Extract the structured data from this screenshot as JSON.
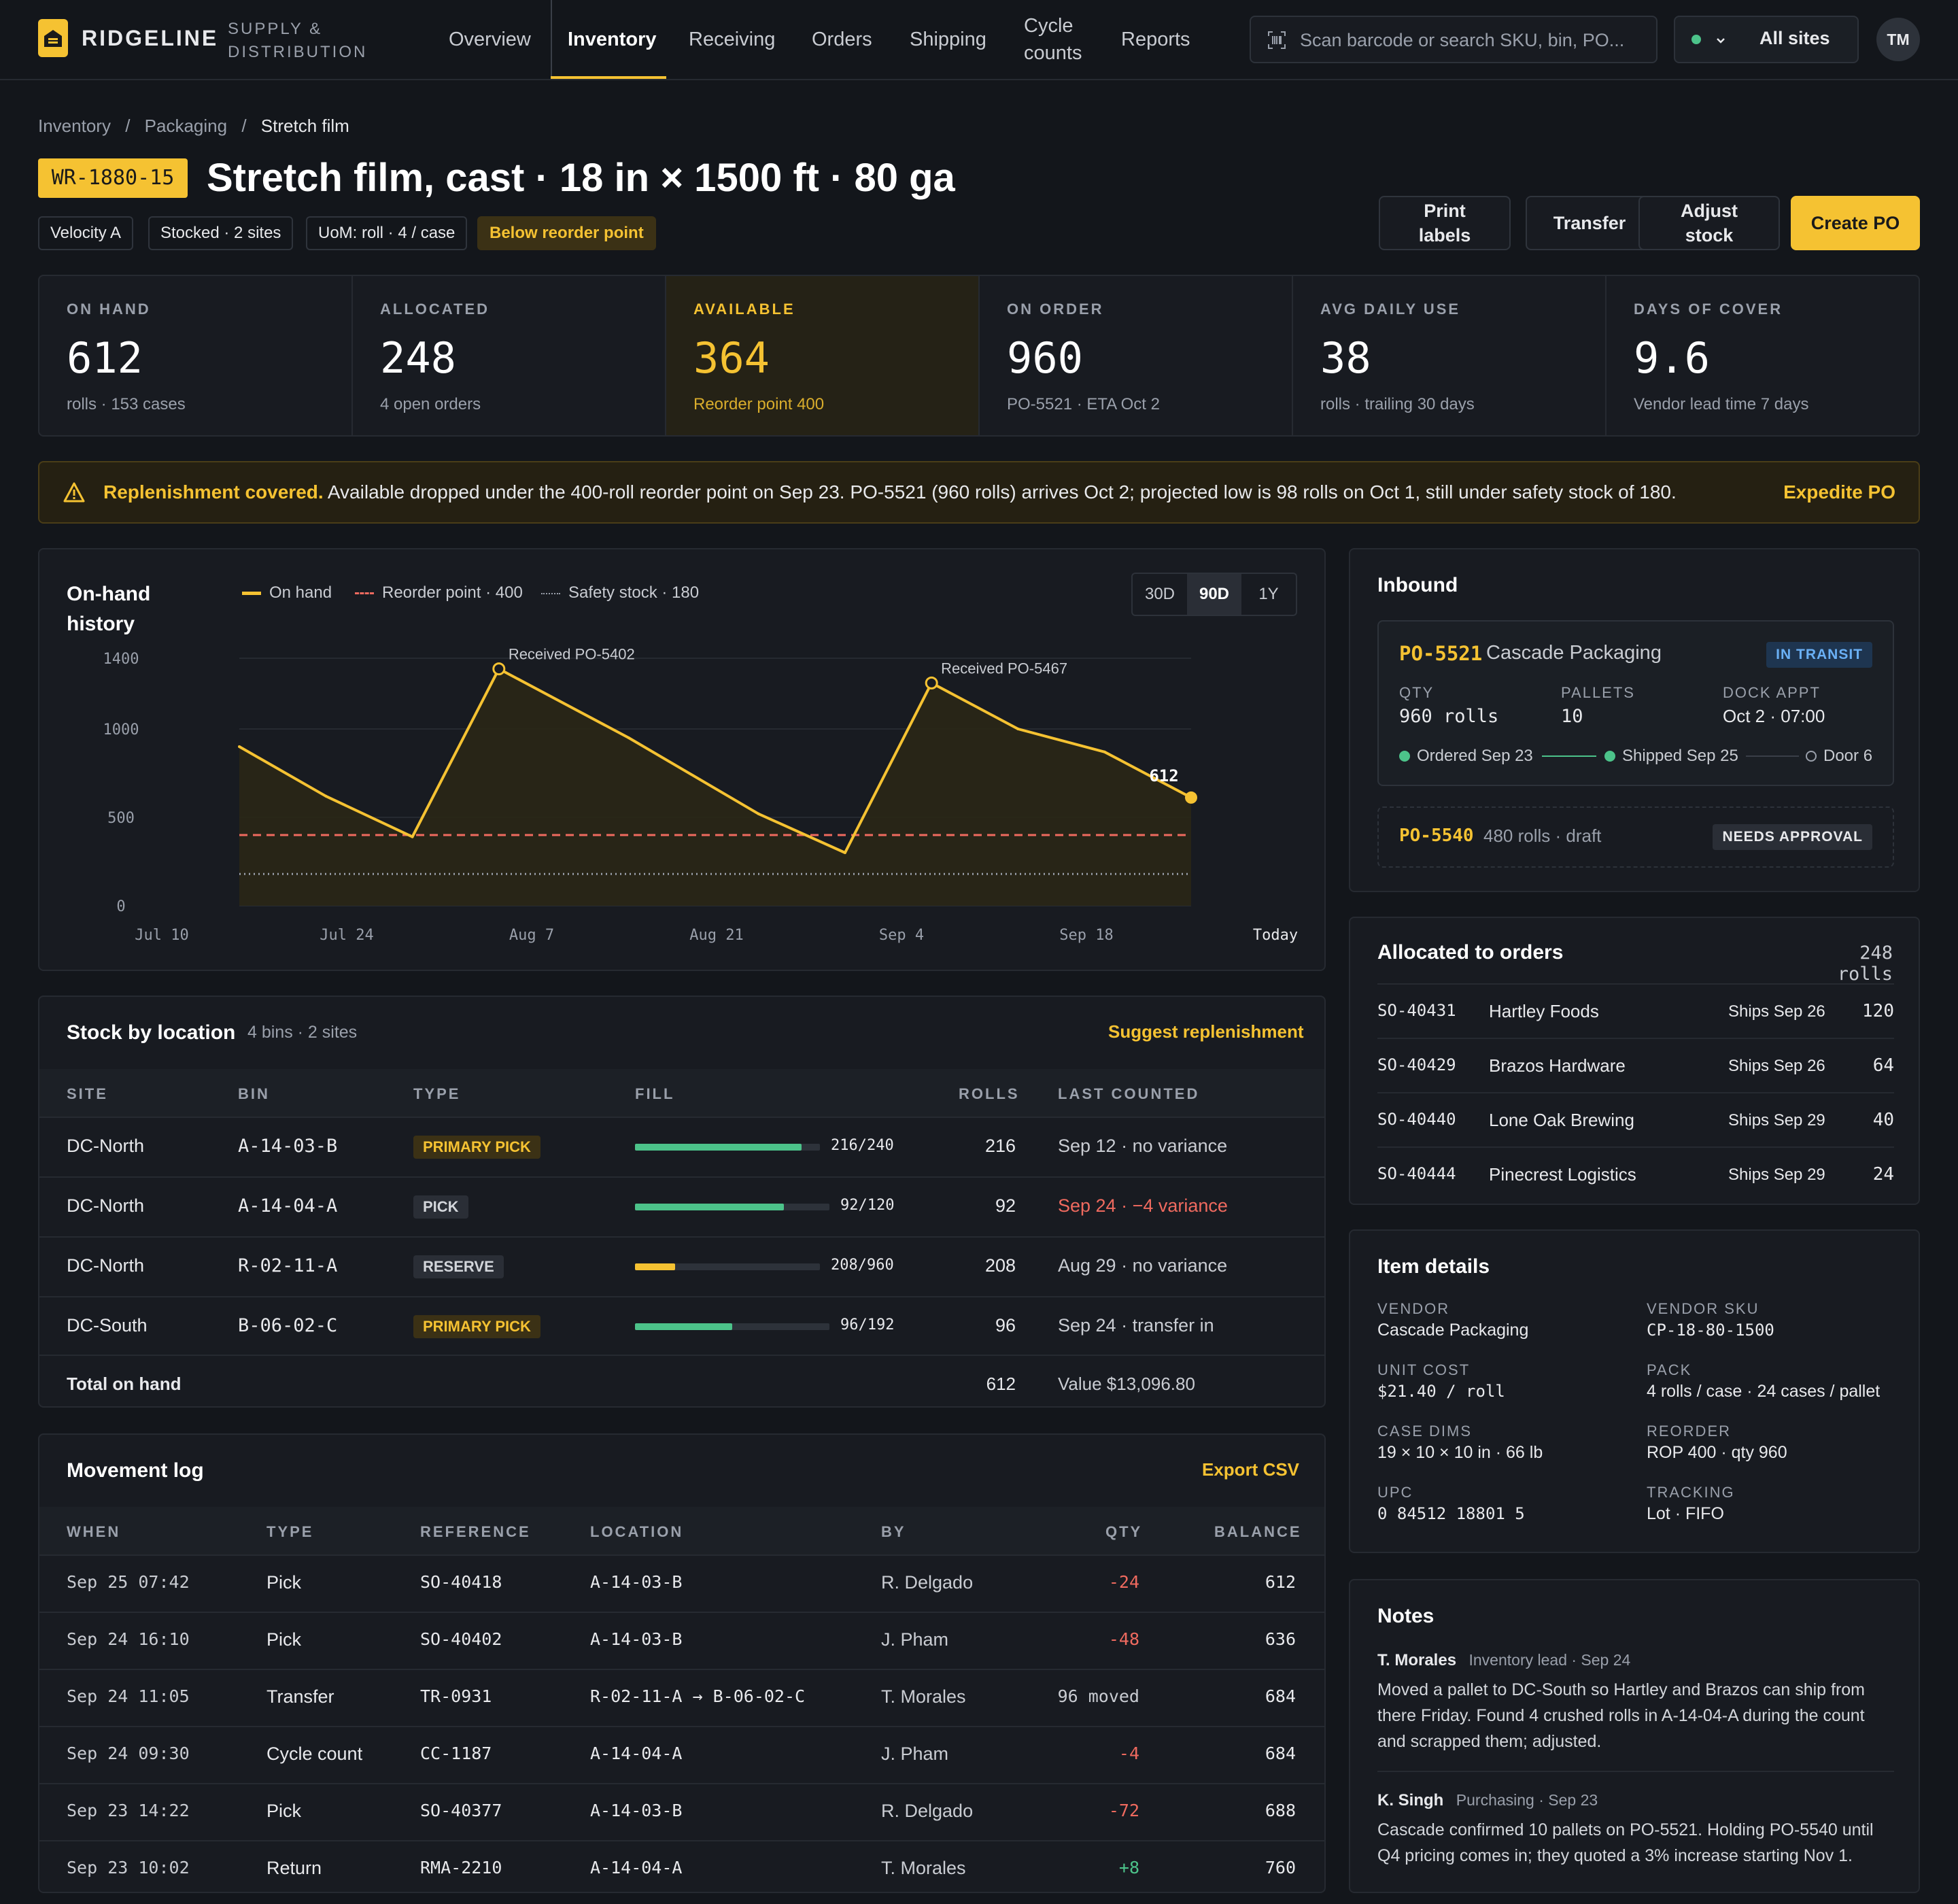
{
  "brand": {
    "name": "RIDGELINE",
    "sub": "SUPPLY & DISTRIBUTION"
  },
  "nav": [
    "Overview",
    "Inventory",
    "Receiving",
    "Orders",
    "Shipping",
    "Cycle counts",
    "Reports"
  ],
  "search": {
    "placeholder": "Scan barcode or search SKU, bin, PO..."
  },
  "sites": {
    "label": "All sites"
  },
  "user": {
    "initials": "TM"
  },
  "breadcrumb": [
    "Inventory",
    "Packaging",
    "Stretch film"
  ],
  "item": {
    "sku": "WR-1880-15",
    "title": "Stretch film, cast · 18 in × 1500 ft · 80 ga",
    "chips": [
      "Velocity A",
      "Stocked · 2 sites",
      "UoM: roll · 4 / case",
      "Below reorder point"
    ]
  },
  "actions": {
    "print": "Print labels",
    "transfer": "Transfer",
    "adjust": "Adjust stock",
    "create": "Create PO"
  },
  "kpis": [
    {
      "label": "ON HAND",
      "value": "612",
      "sub": "rolls · 153 cases"
    },
    {
      "label": "ALLOCATED",
      "value": "248",
      "sub": "4 open orders"
    },
    {
      "label": "AVAILABLE",
      "value": "364",
      "sub": "Reorder point 400"
    },
    {
      "label": "ON ORDER",
      "value": "960",
      "sub": "PO-5521 · ETA Oct 2"
    },
    {
      "label": "AVG DAILY USE",
      "value": "38",
      "sub": "rolls · trailing 30 days"
    },
    {
      "label": "DAYS OF COVER",
      "value": "9.6",
      "sub": "Vendor lead time 7 days"
    }
  ],
  "banner": {
    "bold": "Replenishment covered.",
    "text": "Available dropped under the 400-roll reorder point on Sep 23. PO-5521 (960 rolls) arrives Oct 2; projected low is 98 rolls on Oct 1, still under safety stock of 180.",
    "action": "Expedite PO"
  },
  "chart_card": {
    "title": "On-hand history",
    "ranges": [
      "30D",
      "90D",
      "1Y"
    ],
    "active_range": "90D"
  },
  "chart_data": {
    "type": "line",
    "title": "On-hand history",
    "series": [
      {
        "name": "On hand",
        "color": "#f5c232",
        "x": [
          0,
          10,
          20,
          30,
          45,
          60,
          70,
          80,
          90,
          100,
          110
        ],
        "values": [
          900,
          620,
          390,
          1340,
          950,
          520,
          300,
          1260,
          1000,
          870,
          612
        ]
      }
    ],
    "reference_lines": [
      {
        "name": "Reorder point · 400",
        "value": 400,
        "style": "dashed",
        "color": "#ef6a5f"
      },
      {
        "name": "Safety stock · 180",
        "value": 180,
        "style": "dotted",
        "color": "#9aa0ab"
      }
    ],
    "annotations": [
      {
        "x": 30,
        "y": 1340,
        "text": "Received PO-5402"
      },
      {
        "x": 80,
        "y": 1260,
        "text": "Received PO-5467"
      },
      {
        "x": 110,
        "y": 612,
        "text": "612"
      }
    ],
    "x_tick_labels": [
      "Jul 10",
      "Jul 24",
      "Aug 7",
      "Aug 21",
      "Sep 4",
      "Sep 18",
      "Today"
    ],
    "x_ticks": [
      0,
      14,
      28,
      42,
      56,
      70,
      84
    ],
    "y_ticks": [
      0,
      500,
      1000,
      1400
    ],
    "ylim": [
      0,
      1400
    ],
    "legend": "top"
  },
  "inbound": {
    "title": "Inbound",
    "po": "PO-5521",
    "vendor": "Cascade Packaging",
    "status": "IN TRANSIT",
    "qty_label": "QTY",
    "qty": "960 rolls",
    "pallets_label": "PALLETS",
    "pallets": "10",
    "dock_label": "DOCK APPT",
    "dock": "Oct 2 · 07:00",
    "steps": [
      "Ordered Sep 23",
      "Shipped Sep 25",
      "Door 6"
    ],
    "draft_po": "PO-5540",
    "draft_text": "480 rolls · draft",
    "draft_status": "NEEDS APPROVAL"
  },
  "allocated": {
    "title": "Allocated to orders",
    "total": "248 rolls",
    "rows": [
      {
        "so": "SO-40431",
        "customer": "Hartley Foods",
        "ships": "Ships Sep 26",
        "qty": "120"
      },
      {
        "so": "SO-40429",
        "customer": "Brazos Hardware",
        "ships": "Ships Sep 26",
        "qty": "64"
      },
      {
        "so": "SO-40440",
        "customer": "Lone Oak Brewing",
        "ships": "Ships Sep 29",
        "qty": "40"
      },
      {
        "so": "SO-40444",
        "customer": "Pinecrest Logistics",
        "ships": "Ships Sep 29",
        "qty": "24"
      }
    ]
  },
  "details": {
    "title": "Item details",
    "fields": [
      {
        "label": "VENDOR",
        "value": "Cascade Packaging"
      },
      {
        "label": "VENDOR SKU",
        "value": "CP-18-80-1500"
      },
      {
        "label": "UNIT COST",
        "value": "$21.40 / roll"
      },
      {
        "label": "PACK",
        "value": "4 rolls / case · 24 cases / pallet"
      },
      {
        "label": "CASE DIMS",
        "value": "19 × 10 × 10 in · 66 lb"
      },
      {
        "label": "REORDER",
        "value": "ROP 400 · qty 960"
      },
      {
        "label": "UPC",
        "value": "0 84512 18801 5"
      },
      {
        "label": "TRACKING",
        "value": "Lot · FIFO"
      }
    ]
  },
  "notes": {
    "title": "Notes",
    "items": [
      {
        "author": "T. Morales",
        "meta": "Inventory lead · Sep 24",
        "text": "Moved a pallet to DC-South so Hartley and Brazos can ship from there Friday. Found 4 crushed rolls in A-14-04-A during the count and scrapped them; adjusted."
      },
      {
        "author": "K. Singh",
        "meta": "Purchasing · Sep 23",
        "text": "Cascade confirmed 10 pallets on PO-5521. Holding PO-5540 until Q4 pricing comes in; they quoted a 3% increase starting Nov 1."
      }
    ]
  },
  "stock": {
    "title": "Stock by location",
    "meta": "4 bins · 2 sites",
    "action": "Suggest replenishment",
    "headers": [
      "SITE",
      "BIN",
      "TYPE",
      "FILL",
      "ROLLS",
      "LAST COUNTED"
    ],
    "rows": [
      {
        "site": "DC-North",
        "bin": "A-14-03-B",
        "type": "PRIMARY PICK",
        "fill": 0.9,
        "fill_text": "216/240",
        "rolls": "216",
        "counted": "Sep 12 · no variance",
        "color": "#4cc38a"
      },
      {
        "site": "DC-North",
        "bin": "A-14-04-A",
        "type": "PICK",
        "fill": 0.7667,
        "fill_text": "92/120",
        "rolls": "92",
        "counted": "Sep 24 · −4 variance",
        "color": "#4cc38a"
      },
      {
        "site": "DC-North",
        "bin": "R-02-11-A",
        "type": "RESERVE",
        "fill": 0.2167,
        "fill_text": "208/960",
        "rolls": "208",
        "counted": "Aug 29 · no variance",
        "color": "#f5c232"
      },
      {
        "site": "DC-South",
        "bin": "B-06-02-C",
        "type": "PRIMARY PICK",
        "fill": 0.5,
        "fill_text": "96/192",
        "rolls": "96",
        "counted": "Sep 24 · transfer in",
        "color": "#4cc38a"
      }
    ],
    "total_label": "Total on hand",
    "total": "612",
    "value": "Value $13,096.80"
  },
  "movement": {
    "title": "Movement log",
    "action": "Export CSV",
    "headers": [
      "WHEN",
      "TYPE",
      "REFERENCE",
      "LOCATION",
      "BY",
      "QTY",
      "BALANCE"
    ],
    "rows": [
      {
        "when": "Sep 25 07:42",
        "type": "Pick",
        "ref": "SO-40418",
        "loc": "A-14-03-B",
        "by": "R. Delgado",
        "qty": "-24",
        "bal": "612"
      },
      {
        "when": "Sep 24 16:10",
        "type": "Pick",
        "ref": "SO-40402",
        "loc": "A-14-03-B",
        "by": "J. Pham",
        "qty": "-48",
        "bal": "636"
      },
      {
        "when": "Sep 24 11:05",
        "type": "Transfer",
        "ref": "TR-0931",
        "loc": "R-02-11-A → B-06-02-C",
        "by": "T. Morales",
        "qty": "96 moved",
        "bal": "684"
      },
      {
        "when": "Sep 24 09:30",
        "type": "Cycle count",
        "ref": "CC-1187",
        "loc": "A-14-04-A",
        "by": "J. Pham",
        "qty": "-4",
        "bal": "684"
      },
      {
        "when": "Sep 23 14:22",
        "type": "Pick",
        "ref": "SO-40377",
        "loc": "A-14-03-B",
        "by": "R. Delgado",
        "qty": "-72",
        "bal": "688"
      },
      {
        "when": "Sep 23 10:02",
        "type": "Return",
        "ref": "RMA-2210",
        "loc": "A-14-04-A",
        "by": "T. Morales",
        "qty": "+8",
        "bal": "760"
      }
    ]
  }
}
